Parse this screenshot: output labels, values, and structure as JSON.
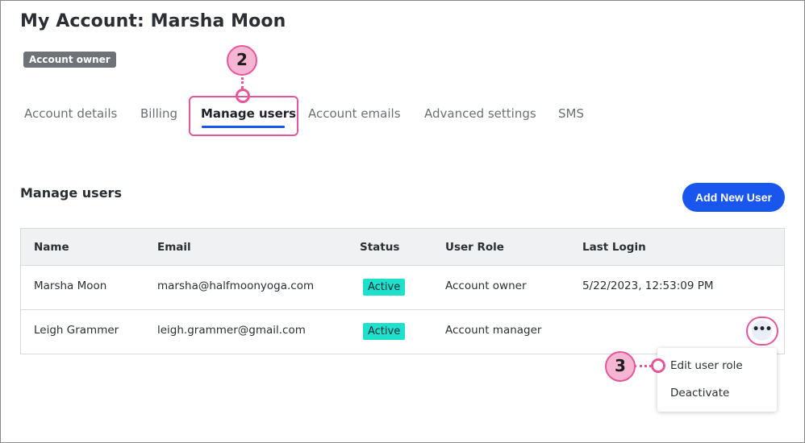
{
  "page": {
    "title": "My Account: Marsha Moon",
    "role_badge": "Account owner"
  },
  "tabs": [
    {
      "label": "Account details"
    },
    {
      "label": "Billing"
    },
    {
      "label": "Manage users"
    },
    {
      "label": "Account emails"
    },
    {
      "label": "Advanced settings"
    },
    {
      "label": "SMS"
    }
  ],
  "active_tab": "Manage users",
  "callouts": {
    "tabs_step": "2",
    "menu_step": "3"
  },
  "section": {
    "title": "Manage users",
    "add_button": "Add New User"
  },
  "table": {
    "columns": [
      "Name",
      "Email",
      "Status",
      "User Role",
      "Last Login"
    ],
    "rows": [
      {
        "name": "Marsha Moon",
        "email": "marsha@halfmoonyoga.com",
        "status": "Active",
        "role": "Account owner",
        "last_login": "5/22/2023, 12:53:09 PM"
      },
      {
        "name": "Leigh Grammer",
        "email": "leigh.grammer@gmail.com",
        "status": "Active",
        "role": "Account manager",
        "last_login": ""
      }
    ]
  },
  "more_button": {
    "label": "•••"
  },
  "row_menu": {
    "items": [
      {
        "label": "Edit user role"
      },
      {
        "label": "Deactivate"
      }
    ]
  },
  "colors": {
    "accent_blue": "#1856ed",
    "highlight_pink": "#e5579b",
    "status_teal": "#1fe0cc",
    "badge_gray": "#6f7377"
  }
}
